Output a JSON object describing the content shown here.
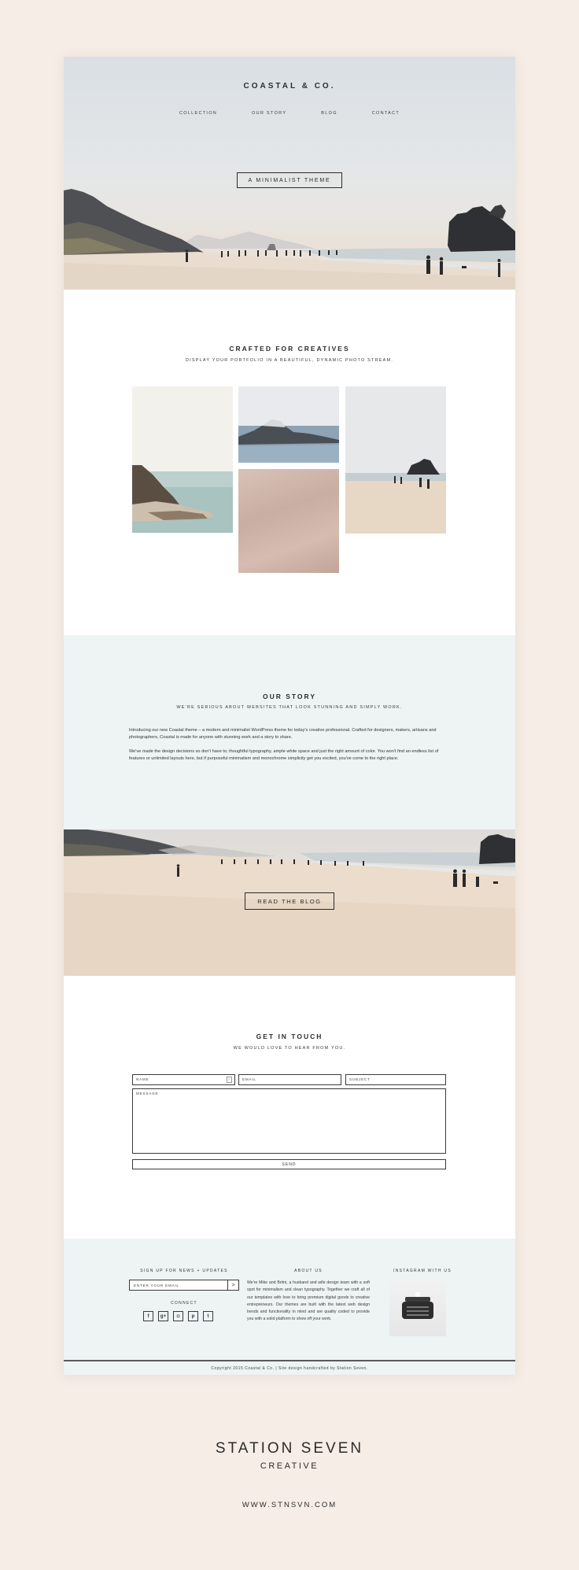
{
  "hero": {
    "brand": "COASTAL & CO.",
    "nav": [
      "COLLECTION",
      "OUR STORY",
      "BLOG",
      "CONTACT"
    ],
    "button": "A MINIMALIST THEME"
  },
  "crafted": {
    "title": "CRAFTED FOR CREATIVES",
    "subtitle": "DISPLAY YOUR PORTFOLIO IN A BEAUTIFUL, DYNAMIC PHOTO STREAM."
  },
  "story": {
    "title": "OUR STORY",
    "subtitle": "WE'RE SERIOUS ABOUT WEBSITES THAT LOOK STUNNING AND SIMPLY WORK.",
    "p1": "Introducing our new Coastal theme – a modern and minimalist WordPress theme for today's creative professional. Crafted for designers, makers, artisans and photographers, Coastal is made for anyone with stunning work and a story to share.",
    "p2": "We've made the design decisions so don't have to; thoughtful typography, ample white space and just the right amount of color. You won't find an endless list of features or unlimited layouts here, but if purposeful minimalism and monochrome simplicity get you excited, you've come to the right place."
  },
  "blog": {
    "button": "READ THE BLOG"
  },
  "contact": {
    "title": "GET IN TOUCH",
    "subtitle": "WE WOULD LOVE TO HEAR FROM YOU.",
    "name_placeholder": "NAME",
    "email_placeholder": "EMAIL",
    "subject_placeholder": "SUBJECT",
    "message_placeholder": "MESSAGE",
    "send": "SEND"
  },
  "footer": {
    "signup_title": "SIGN UP FOR NEWS + UPDATES",
    "email_placeholder": "ENTER YOUR EMAIL",
    "submit": ">",
    "connect_title": "CONNECT",
    "social_icons": [
      "facebook-icon",
      "google-plus-icon",
      "instagram-icon",
      "pinterest-icon",
      "twitter-icon"
    ],
    "social_glyphs": [
      "f",
      "g+",
      "◘",
      "p",
      "t"
    ],
    "about_title": "ABOUT US",
    "about_text": "We're Mike and Britni, a husband and wife design team with a soft spot for minimalism and clean typography. Together we craft all of our templates with love to bring premium digital goods to creative entrepreneurs. Our themes are built with the latest web design trends and functionality in mind and are quality coded to provide you with a solid platform to show off your work.",
    "instagram_title": "INSTAGRAM WITH US",
    "copyright": "Copyright 2015 Coastal & Co. | Site design handcrafted by Station Seven."
  },
  "studio": {
    "name": "STATION SEVEN",
    "tag": "CREATIVE",
    "url": "WWW.STNSVN.COM"
  }
}
